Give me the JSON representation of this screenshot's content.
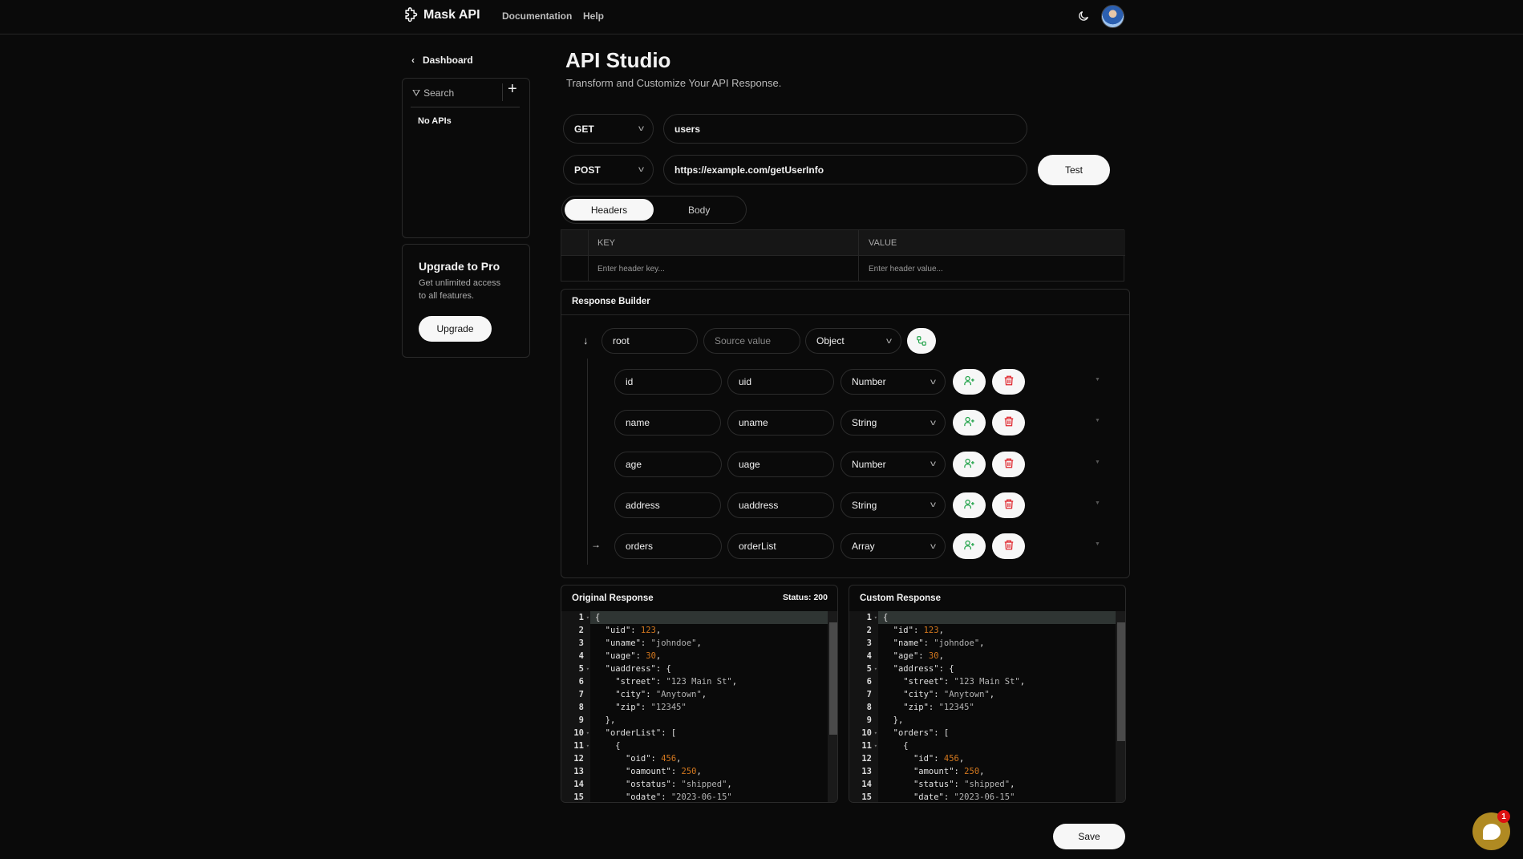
{
  "header": {
    "app_name": "Mask API",
    "nav": [
      "Documentation",
      "Help"
    ]
  },
  "sidebar": {
    "back_label": "Dashboard",
    "search_label": "Search",
    "empty_label": "No APIs",
    "upgrade": {
      "title": "Upgrade to Pro",
      "desc_line1": "Get unlimited access",
      "desc_line2": "to all features.",
      "button": "Upgrade"
    }
  },
  "main": {
    "title": "API Studio",
    "subtitle": "Transform and Customize Your API Response.",
    "row1": {
      "method": "GET",
      "value": "users"
    },
    "row2": {
      "method": "POST",
      "value": "https://example.com/getUserInfo",
      "test_label": "Test"
    },
    "tabs": [
      {
        "label": "Headers",
        "active": true
      },
      {
        "label": "Body",
        "active": false
      }
    ],
    "headers_table": {
      "key_col": "KEY",
      "value_col": "VALUE",
      "key_placeholder": "Enter header key...",
      "value_placeholder": "Enter header value..."
    },
    "builder": {
      "title": "Response Builder",
      "root": {
        "name": "root",
        "source_placeholder": "Source value",
        "type": "Object"
      },
      "fields": [
        {
          "name": "id",
          "source": "uid",
          "type": "Number",
          "expandable": false
        },
        {
          "name": "name",
          "source": "uname",
          "type": "String",
          "expandable": false
        },
        {
          "name": "age",
          "source": "uage",
          "type": "Number",
          "expandable": false
        },
        {
          "name": "address",
          "source": "uaddress",
          "type": "String",
          "expandable": false
        },
        {
          "name": "orders",
          "source": "orderList",
          "type": "Array",
          "expandable": true
        }
      ]
    },
    "original": {
      "title": "Original Response",
      "status": "Status: 200",
      "lines": [
        "{",
        "  \"uid\": 123,",
        "  \"uname\": \"johndoe\",",
        "  \"uage\": 30,",
        "  \"uaddress\": {",
        "    \"street\": \"123 Main St\",",
        "    \"city\": \"Anytown\",",
        "    \"zip\": \"12345\"",
        "  },",
        "  \"orderList\": [",
        "    {",
        "      \"oid\": 456,",
        "      \"oamount\": 250,",
        "      \"ostatus\": \"shipped\",",
        "      \"odate\": \"2023-06-15\""
      ]
    },
    "custom": {
      "title": "Custom Response",
      "lines": [
        "{",
        "  \"id\": 123,",
        "  \"name\": \"johndoe\",",
        "  \"age\": 30,",
        "  \"address\": {",
        "    \"street\": \"123 Main St\",",
        "    \"city\": \"Anytown\",",
        "    \"zip\": \"12345\"",
        "  },",
        "  \"orders\": [",
        "    {",
        "      \"id\": 456,",
        "      \"amount\": 250,",
        "      \"status\": \"shipped\",",
        "      \"date\": \"2023-06-15\""
      ]
    },
    "save_label": "Save"
  },
  "chat": {
    "badge": "1",
    "color": "#b08a22"
  },
  "colors": {
    "add": "#22a34a",
    "delete": "#e0242b",
    "number": "#d4781e"
  }
}
